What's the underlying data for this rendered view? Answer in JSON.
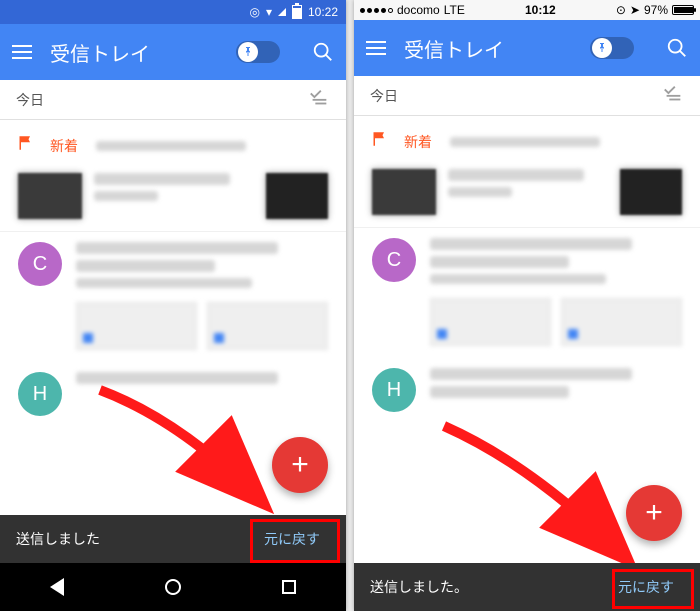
{
  "left": {
    "status": {
      "time": "10:22"
    },
    "header": {
      "title": "受信トレイ"
    },
    "section": {
      "label": "今日"
    },
    "new_label": "新着",
    "avatar_c": "C",
    "avatar_h": "H",
    "fab_glyph": "+",
    "snackbar": {
      "message": "送信しました",
      "undo": "元に戻す"
    }
  },
  "right": {
    "status": {
      "carrier": "docomo",
      "network": "LTE",
      "time": "10:12",
      "battery_pct": "97%"
    },
    "header": {
      "title": "受信トレイ"
    },
    "section": {
      "label": "今日"
    },
    "new_label": "新着",
    "avatar_c": "C",
    "avatar_h": "H",
    "fab_glyph": "+",
    "snackbar": {
      "message": "送信しました。",
      "undo": "元に戻す"
    }
  }
}
